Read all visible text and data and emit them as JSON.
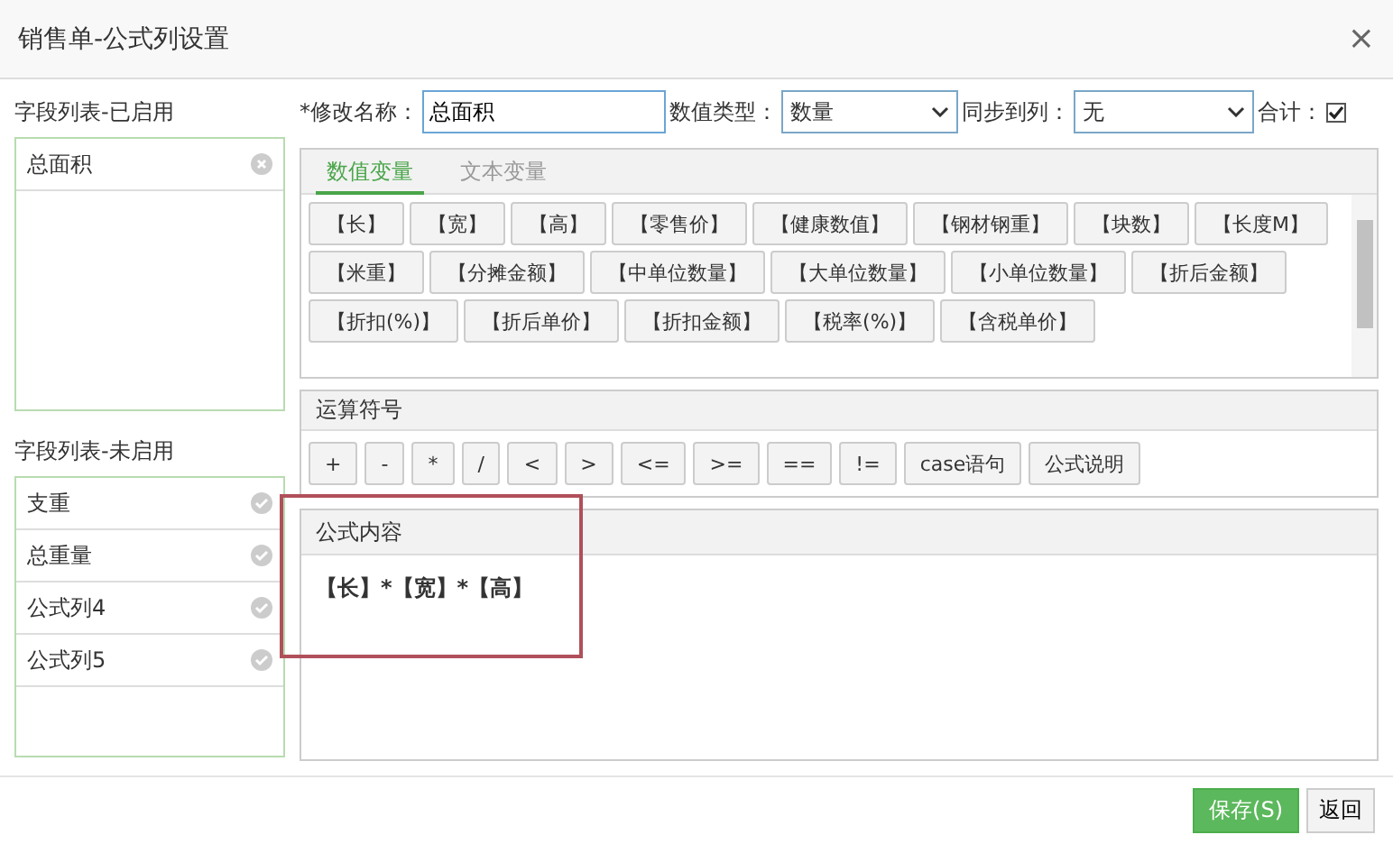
{
  "window": {
    "title": "销售单-公式列设置",
    "close": "×"
  },
  "enabled_fields": {
    "title": "字段列表-已启用",
    "items": [
      {
        "label": "总面积"
      }
    ]
  },
  "disabled_fields": {
    "title": "字段列表-未启用",
    "items": [
      {
        "label": "支重"
      },
      {
        "label": "总重量"
      },
      {
        "label": "公式列4"
      },
      {
        "label": "公式列5"
      }
    ]
  },
  "form": {
    "name_label": "*修改名称：",
    "name_value": "总面积",
    "type_label": "数值类型：",
    "type_value": "数量",
    "sync_label": "同步到列：",
    "sync_value": "无",
    "total_label": "合计：",
    "total_checked": true
  },
  "variable_tabs": [
    {
      "label": "数值变量",
      "selected": true
    },
    {
      "label": "文本变量",
      "selected": false
    }
  ],
  "variables": [
    "【长】",
    "【宽】",
    "【高】",
    "【零售价】",
    "【健康数值】",
    "【钢材钢重】",
    "【块数】",
    "【长度M】",
    "【米重】",
    "【分摊金额】",
    "【中单位数量】",
    "【大单位数量】",
    "【小单位数量】",
    "【折后金额】",
    "【折扣(%)】",
    "【折后单价】",
    "【折扣金额】",
    "【税率(%)】",
    "【含税单价】"
  ],
  "operators": {
    "title": "运算符号",
    "buttons": [
      "+",
      "-",
      "*",
      "/",
      "<",
      ">",
      "<=",
      ">=",
      "==",
      "!=",
      "case语句",
      "公式说明"
    ]
  },
  "formula": {
    "title": "公式内容",
    "value": "【长】*【宽】*【高】"
  },
  "footer": {
    "save": "保存(S)",
    "back": "返回"
  }
}
